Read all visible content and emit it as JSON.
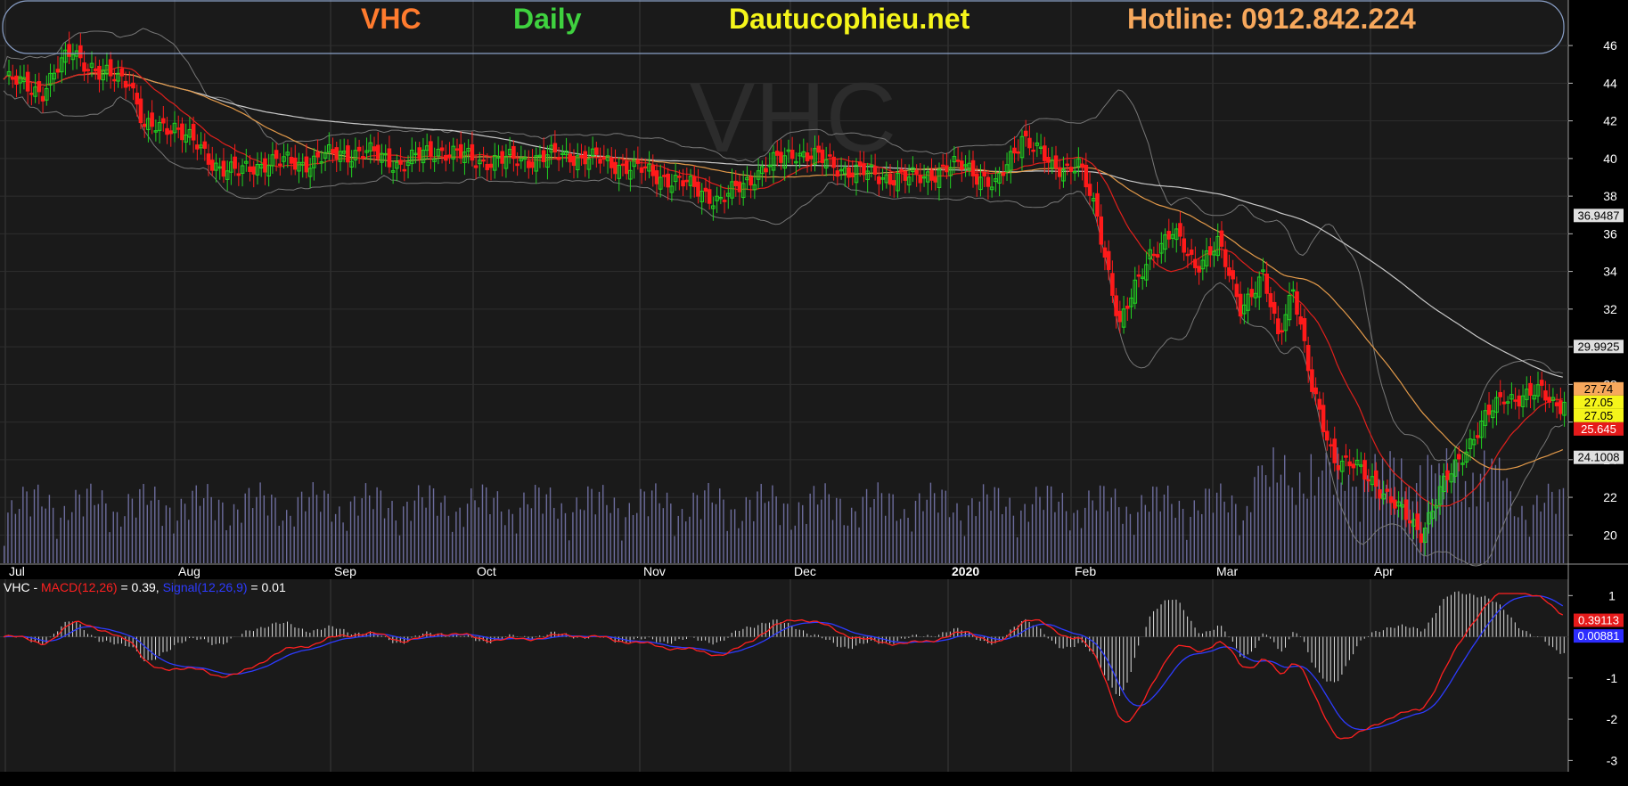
{
  "header": {
    "symbol": "VHC",
    "period": "Daily",
    "site": "Dautucophieu.net",
    "hotline": "Hotline: 0912.842.224"
  },
  "colors": {
    "symbol": "#ff7b2e",
    "period": "#3fd23f",
    "site": "#f5f51a",
    "hotline": "#f7a85c",
    "up_candle": "#22d322",
    "down_candle": "#ff1a1a",
    "ma_fast": "#e0201c",
    "ma_mid": "#e39a4a",
    "ma_slow": "#c9c9c9",
    "macd": "#ff2020",
    "signal": "#2d3bff",
    "volume": "#6c6c9c"
  },
  "watermark": "VHC",
  "macd_legend": {
    "prefix": "VHC - ",
    "macd_label": "MACD(12,26)",
    "macd_value": " = 0.39, ",
    "signal_label": "Signal(12,26,9)",
    "signal_value": " = 0.01"
  },
  "chart_data": {
    "type": "candlestick",
    "x_labels": [
      "Jul",
      "Aug",
      "Sep",
      "Oct",
      "Nov",
      "Dec",
      "2020",
      "Feb",
      "Mar",
      "Apr"
    ],
    "y_ticks": [
      20,
      22,
      24,
      26,
      28,
      30,
      32,
      34,
      36,
      38,
      40,
      42,
      44,
      46
    ],
    "ylim": [
      18.5,
      47
    ],
    "macd_ticks": [
      "1",
      "-1",
      "-2",
      "-3"
    ],
    "macd_ylim": [
      -3.1,
      1.05
    ],
    "price_tags": [
      {
        "label": "36.9487",
        "value": 36.95,
        "bg": "#e0e0e0",
        "fg": "#000000"
      },
      {
        "label": "29.9925",
        "value": 29.99,
        "bg": "#e0e0e0",
        "fg": "#000000"
      },
      {
        "label": "27.74",
        "value": 27.74,
        "bg": "#f7a85c",
        "fg": "#000000"
      },
      {
        "label": "27.05",
        "value": 27.05,
        "bg": "#f5f51a",
        "fg": "#000000"
      },
      {
        "label": "27.05",
        "value": 27.05,
        "bg": "#f5f51a",
        "fg": "#000000"
      },
      {
        "label": "25.645",
        "value": 25.645,
        "bg": "#e51a1a",
        "fg": "#ffffff"
      },
      {
        "label": "24.1008",
        "value": 24.1,
        "bg": "#e0e0e0",
        "fg": "#000000"
      }
    ],
    "macd_tags": [
      {
        "label": "0.39113",
        "value": 0.39,
        "bg": "#e51a1a",
        "fg": "#ffffff"
      },
      {
        "label": "0.00881",
        "value": 0.01,
        "bg": "#2d2dff",
        "fg": "#ffffff"
      }
    ],
    "series": [
      {
        "name": "Price",
        "close_keypoints": [
          [
            0,
            44.2
          ],
          [
            10,
            43.6
          ],
          [
            18,
            45.8
          ],
          [
            25,
            44.4
          ],
          [
            33,
            44.3
          ],
          [
            37,
            41.5
          ],
          [
            45,
            41.8
          ],
          [
            55,
            39.8
          ],
          [
            62,
            39.2
          ],
          [
            70,
            39.9
          ],
          [
            78,
            39.7
          ],
          [
            85,
            40.1
          ],
          [
            95,
            40.4
          ],
          [
            105,
            39.7
          ],
          [
            115,
            40.5
          ],
          [
            125,
            39.9
          ],
          [
            135,
            39.9
          ],
          [
            150,
            40.2
          ],
          [
            165,
            39.6
          ],
          [
            175,
            39.0
          ],
          [
            185,
            38.3
          ],
          [
            190,
            37.7
          ],
          [
            200,
            39.3
          ],
          [
            210,
            40.4
          ],
          [
            225,
            39.3
          ],
          [
            240,
            38.9
          ],
          [
            255,
            39.7
          ],
          [
            263,
            38.4
          ],
          [
            270,
            41.3
          ],
          [
            278,
            39.5
          ],
          [
            285,
            39.7
          ],
          [
            290,
            36.8
          ],
          [
            296,
            31.2
          ],
          [
            300,
            33.0
          ],
          [
            304,
            35.0
          ],
          [
            310,
            36.0
          ],
          [
            316,
            34.4
          ],
          [
            322,
            35.4
          ],
          [
            328,
            32.2
          ],
          [
            334,
            33.6
          ],
          [
            338,
            30.6
          ],
          [
            342,
            33.3
          ],
          [
            347,
            27.6
          ],
          [
            353,
            24.1
          ],
          [
            358,
            23.6
          ],
          [
            364,
            22.8
          ],
          [
            370,
            21.3
          ],
          [
            376,
            20.2
          ],
          [
            382,
            22.6
          ],
          [
            388,
            24.7
          ],
          [
            393,
            26.1
          ],
          [
            398,
            27.4
          ],
          [
            404,
            27.3
          ],
          [
            408,
            27.6
          ],
          [
            412,
            27.05
          ]
        ]
      }
    ],
    "volume_ylim": [
      0,
      4
    ]
  }
}
